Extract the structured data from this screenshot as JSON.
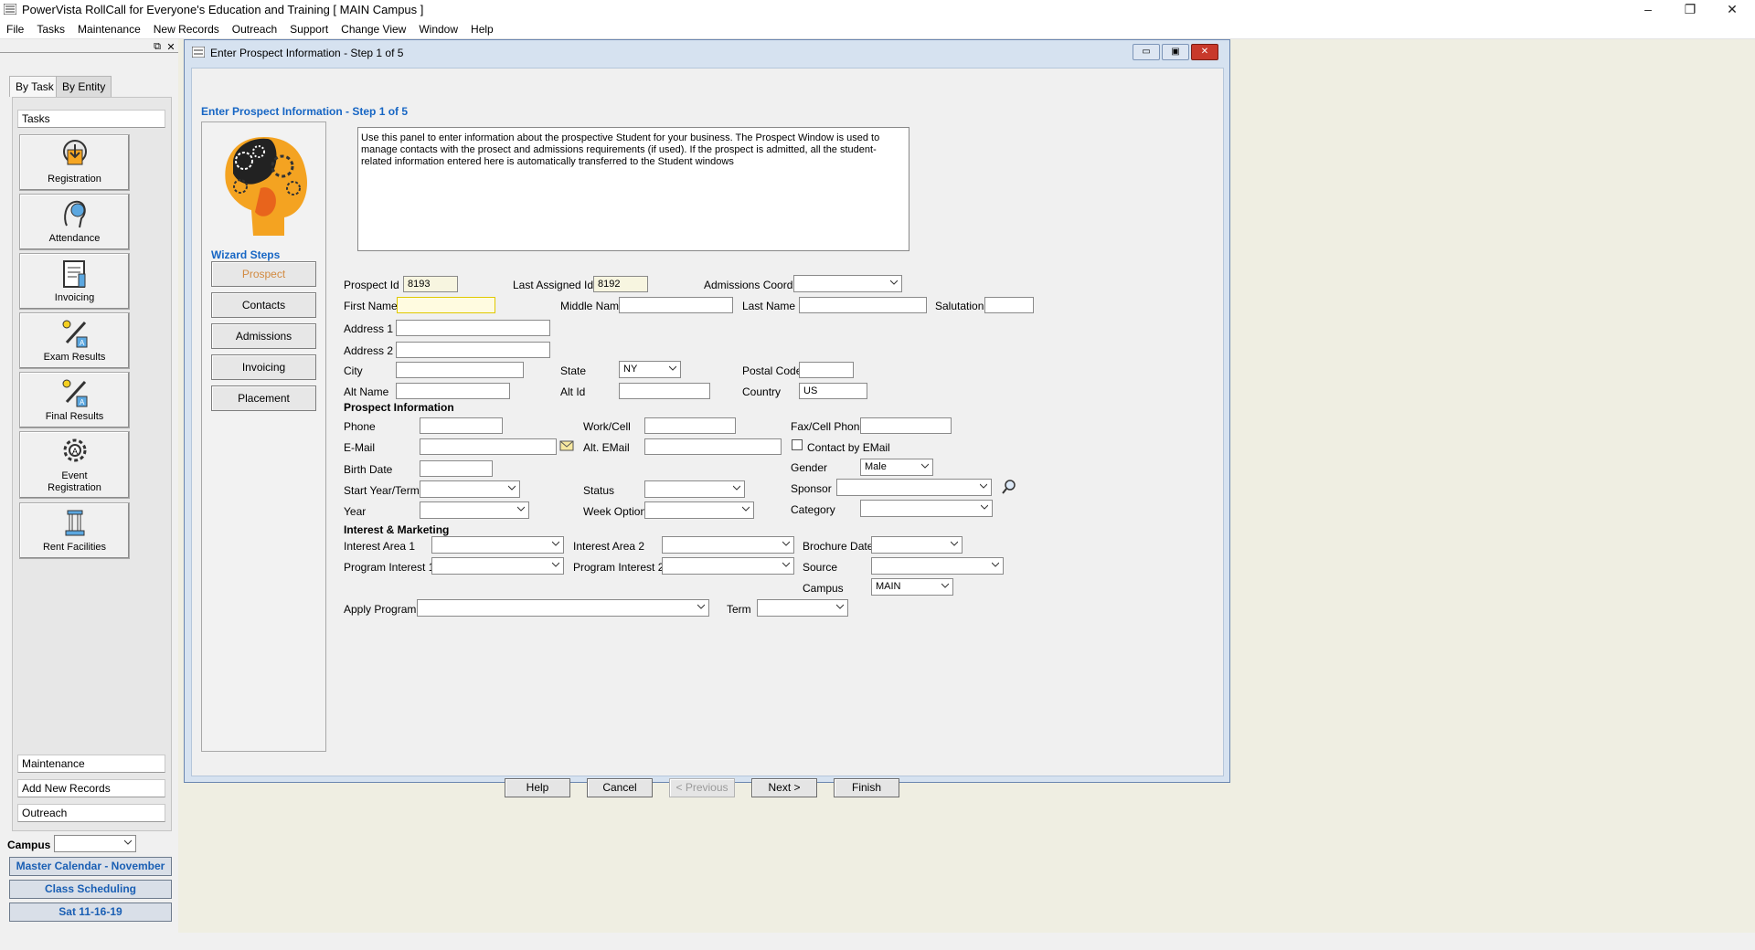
{
  "app": {
    "title": "PowerVista RollCall for Everyone's Education and Training   [ MAIN Campus ]",
    "window_controls": [
      "–",
      "❐",
      "✕"
    ]
  },
  "menu": [
    "File",
    "Tasks",
    "Maintenance",
    "New Records",
    "Outreach",
    "Support",
    "Change View",
    "Window",
    "Help"
  ],
  "left_panel": {
    "tabs": [
      "By Task",
      "By Entity"
    ],
    "tasks_header": "Tasks",
    "tasks": [
      {
        "label": "Registration",
        "icon": "registration-icon"
      },
      {
        "label": "Attendance",
        "icon": "attendance-icon"
      },
      {
        "label": "Invoicing",
        "icon": "invoicing-icon"
      },
      {
        "label": "Exam Results",
        "icon": "exam-results-icon"
      },
      {
        "label": "Final Results",
        "icon": "final-results-icon"
      },
      {
        "label": "Event Registration",
        "icon": "event-registration-icon"
      },
      {
        "label": "Rent Facilities",
        "icon": "rent-facilities-icon"
      }
    ],
    "sections": [
      "Maintenance",
      "Add New Records",
      "Outreach"
    ],
    "campus_label": "Campus",
    "campus_value": "",
    "buttons": [
      "Master Calendar - November",
      "Class Scheduling",
      "Sat 11-16-19"
    ]
  },
  "dialog": {
    "title": "Enter Prospect Information - Step 1 of 5",
    "header": "Enter Prospect Information - Step 1 of 5",
    "wizard_steps_label": "Wizard Steps",
    "steps": [
      "Prospect",
      "Contacts",
      "Admissions",
      "Invoicing",
      "Placement"
    ],
    "active_step": "Prospect",
    "info": "Use this panel to enter information about the prospective Student for your business. The Prospect Window is used to manage contacts with the prosect and admissions requirements (if used). If the prospect is admitted, all the student-related information entered here is automatically transferred to the Student windows",
    "labels": {
      "prospect_id": "Prospect Id",
      "last_assigned_id": "Last Assigned Id",
      "admissions_coord": "Admissions Coord.",
      "first_name": "First Name",
      "middle_name": "Middle Name",
      "last_name": "Last Name",
      "salutation": "Salutation",
      "address1": "Address 1",
      "address2": "Address 2",
      "city": "City",
      "state": "State",
      "postal_code": "Postal Code",
      "alt_name": "Alt Name",
      "alt_id": "Alt Id",
      "country": "Country",
      "prospect_information": "Prospect Information",
      "phone": "Phone",
      "work_cell": "Work/Cell",
      "fax_cell_phone": "Fax/Cell Phone",
      "email": "E-Mail",
      "alt_email": "Alt. EMail",
      "contact_by_email": "Contact by EMail",
      "birth_date": "Birth Date",
      "gender": "Gender",
      "start_year_term": "Start Year/Term",
      "status": "Status",
      "sponsor": "Sponsor",
      "year": "Year",
      "week_option": "Week Option",
      "category": "Category",
      "interest_marketing": "Interest & Marketing",
      "interest_area1": "Interest Area 1",
      "interest_area2": "Interest Area 2",
      "brochure_date": "Brochure Date",
      "program_interest1": "Program Interest 1",
      "program_interest2": "Program Interest 2",
      "source": "Source",
      "campus": "Campus",
      "apply_program": "Apply Program",
      "term": "Term"
    },
    "values": {
      "prospect_id": "8193",
      "last_assigned_id": "8192",
      "state": "NY",
      "country": "US",
      "gender": "Male",
      "campus": "MAIN"
    },
    "buttons": {
      "help": "Help",
      "cancel": "Cancel",
      "previous": "< Previous",
      "next": "Next >",
      "finish": "Finish"
    }
  }
}
